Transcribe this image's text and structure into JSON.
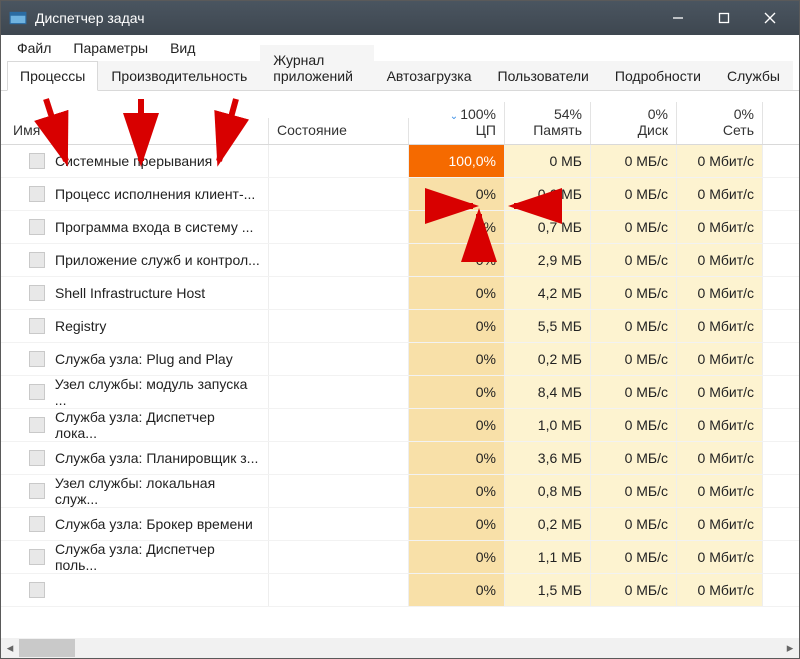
{
  "window": {
    "title": "Диспетчер задач"
  },
  "menu": {
    "file": "Файл",
    "options": "Параметры",
    "view": "Вид"
  },
  "tabs": [
    {
      "label": "Процессы",
      "active": true
    },
    {
      "label": "Производительность",
      "active": false
    },
    {
      "label": "Журнал приложений",
      "active": false
    },
    {
      "label": "Автозагрузка",
      "active": false
    },
    {
      "label": "Пользователи",
      "active": false
    },
    {
      "label": "Подробности",
      "active": false
    },
    {
      "label": "Службы",
      "active": false
    }
  ],
  "columns": {
    "name": "Имя",
    "status": "Состояние",
    "cpu_pct": "100%",
    "cpu_label": "ЦП",
    "mem_pct": "54%",
    "mem_label": "Память",
    "disk_pct": "0%",
    "disk_label": "Диск",
    "net_pct": "0%",
    "net_label": "Сеть"
  },
  "processes": [
    {
      "name": "Системные прерывания",
      "cpu": "100,0%",
      "cpu_hot": true,
      "mem": "0 МБ",
      "disk": "0 МБ/с",
      "net": "0 Мбит/с"
    },
    {
      "name": "Процесс исполнения клиент-...",
      "cpu": "0%",
      "cpu_hot": false,
      "mem": "0,6 МБ",
      "disk": "0 МБ/с",
      "net": "0 Мбит/с"
    },
    {
      "name": "Программа входа в систему ...",
      "cpu": "0%",
      "cpu_hot": false,
      "mem": "0,7 МБ",
      "disk": "0 МБ/с",
      "net": "0 Мбит/с"
    },
    {
      "name": "Приложение служб и контрол...",
      "cpu": "0%",
      "cpu_hot": false,
      "mem": "2,9 МБ",
      "disk": "0 МБ/с",
      "net": "0 Мбит/с"
    },
    {
      "name": "Shell Infrastructure Host",
      "cpu": "0%",
      "cpu_hot": false,
      "mem": "4,2 МБ",
      "disk": "0 МБ/с",
      "net": "0 Мбит/с"
    },
    {
      "name": "Registry",
      "cpu": "0%",
      "cpu_hot": false,
      "mem": "5,5 МБ",
      "disk": "0 МБ/с",
      "net": "0 Мбит/с"
    },
    {
      "name": "Служба узла: Plug and Play",
      "cpu": "0%",
      "cpu_hot": false,
      "mem": "0,2 МБ",
      "disk": "0 МБ/с",
      "net": "0 Мбит/с"
    },
    {
      "name": "Узел службы: модуль запуска ...",
      "cpu": "0%",
      "cpu_hot": false,
      "mem": "8,4 МБ",
      "disk": "0 МБ/с",
      "net": "0 Мбит/с"
    },
    {
      "name": "Служба узла: Диспетчер лока...",
      "cpu": "0%",
      "cpu_hot": false,
      "mem": "1,0 МБ",
      "disk": "0 МБ/с",
      "net": "0 Мбит/с"
    },
    {
      "name": "Служба узла: Планировщик з...",
      "cpu": "0%",
      "cpu_hot": false,
      "mem": "3,6 МБ",
      "disk": "0 МБ/с",
      "net": "0 Мбит/с"
    },
    {
      "name": "Узел службы: локальная служ...",
      "cpu": "0%",
      "cpu_hot": false,
      "mem": "0,8 МБ",
      "disk": "0 МБ/с",
      "net": "0 Мбит/с"
    },
    {
      "name": "Служба узла: Брокер времени",
      "cpu": "0%",
      "cpu_hot": false,
      "mem": "0,2 МБ",
      "disk": "0 МБ/с",
      "net": "0 Мбит/с"
    },
    {
      "name": "Служба узла: Диспетчер поль...",
      "cpu": "0%",
      "cpu_hot": false,
      "mem": "1,1 МБ",
      "disk": "0 МБ/с",
      "net": "0 Мбит/с"
    },
    {
      "name": "",
      "cpu": "0%",
      "cpu_hot": false,
      "mem": "1,5 МБ",
      "disk": "0 МБ/с",
      "net": "0 Мбит/с"
    }
  ],
  "annotations": {
    "arrow_color": "#d80000"
  }
}
